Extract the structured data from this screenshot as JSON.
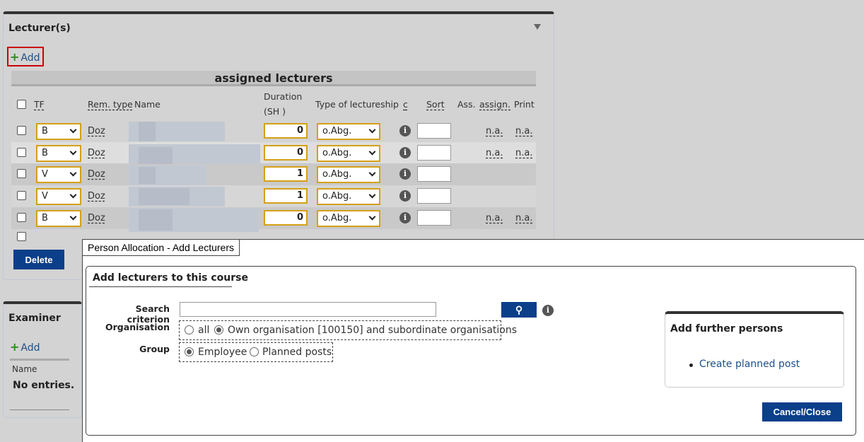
{
  "lecturers_panel": {
    "title": "Lecturer(s)",
    "add_label": "Add",
    "table_caption": "assigned lecturers",
    "headers": {
      "tf": "TF",
      "rem_type": "Rem. type",
      "name": "Name",
      "duration_line1": "Duration",
      "duration_line2": "(SH )",
      "type_of_lectureship": "Type of lectureship",
      "c": "c",
      "sort": "Sort",
      "ass": "Ass.",
      "assign": "assign.",
      "print": "Print"
    },
    "rows": [
      {
        "tf": "B",
        "rem_type": "Doz",
        "duration": "0",
        "lectureship": "o.Abg.",
        "assign": "n.a.",
        "print": "n.a."
      },
      {
        "tf": "B",
        "rem_type": "Doz",
        "duration": "0",
        "lectureship": "o.Abg.",
        "assign": "n.a.",
        "print": "n.a."
      },
      {
        "tf": "V",
        "rem_type": "Doz",
        "duration": "1",
        "lectureship": "o.Abg.",
        "assign": "",
        "print": ""
      },
      {
        "tf": "V",
        "rem_type": "Doz",
        "duration": "1",
        "lectureship": "o.Abg.",
        "assign": "",
        "print": ""
      },
      {
        "tf": "B",
        "rem_type": "Doz",
        "duration": "0",
        "lectureship": "o.Abg.",
        "assign": "n.a.",
        "print": "n.a."
      }
    ],
    "delete_label": "Delete"
  },
  "examiner_panel": {
    "title": "Examiner",
    "add_label": "Add",
    "name_header": "Name",
    "empty_text": "No entries."
  },
  "dialog": {
    "title": "Person Allocation - Add Lecturers",
    "section_title": "Add lecturers to this course",
    "search_label": "Search criterion",
    "search_value": "",
    "organisation_label": "Organisation",
    "org_options": [
      "all",
      "Own organisation [100150] and subordinate organisations"
    ],
    "org_selected": 1,
    "group_label": "Group",
    "group_options": [
      "Employee",
      "Planned posts"
    ],
    "group_selected": 0,
    "further_title": "Add further persons",
    "further_link": "Create planned post",
    "cancel_label": "Cancel/Close",
    "info_glyph": "i"
  },
  "colors": {
    "accent_blue": "#0b3f8a",
    "link_blue": "#1c4f8a",
    "plus_green": "#2e8b22",
    "highlight_red": "#cc0000",
    "field_border_gold": "#d4a017"
  }
}
